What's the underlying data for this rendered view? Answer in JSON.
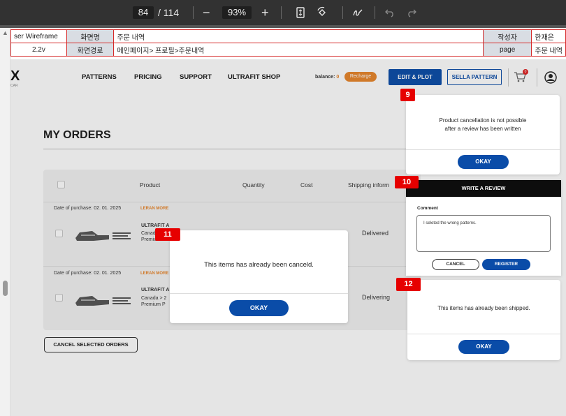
{
  "viewer": {
    "current_page": "84",
    "total_pages": "/ 114",
    "zoom": "93%",
    "minus_label": "−",
    "plus_label": "+"
  },
  "meta_table": {
    "row1": {
      "col1": "ser Wireframe",
      "col2": "화면명",
      "col3": "주문 내역",
      "col4": "작성자",
      "col5": "한재은"
    },
    "row2": {
      "col1": "2.2v",
      "col2": "화면경로",
      "col3": "메인페이지> 프로필>주문내역",
      "col4": "page",
      "col5": "주문 내역"
    }
  },
  "nav": {
    "logo": "X",
    "logo_sub": "CAR",
    "items": [
      "PATTERNS",
      "PRICING",
      "SUPPORT",
      "ULTRAFIT SHOP"
    ],
    "balance_label": "balance:",
    "balance_value": "0",
    "recharge": "Recharge",
    "edit_plot": "EDIT & PLOT",
    "sella_pattern": "SELLA PATTERN",
    "cart_count": "0"
  },
  "orders": {
    "title": "MY ORDERS",
    "headers": {
      "product": "Product",
      "quantity": "Quantity",
      "cost": "Cost",
      "shipping": "Shipping inform"
    },
    "groups": [
      {
        "date": "Date of purchase: 02. 01. 2025",
        "learn_more": "LERAN MORE",
        "product_name": "ULTRAFIT A",
        "line1": "Canada",
        "line2": "Premium",
        "status": "Delivered"
      },
      {
        "date": "Date of purchase: 02. 01. 2025",
        "learn_more": "LERAN MORE",
        "product_name": "ULTRAFIT A",
        "line1": "Canada > 2",
        "line2": "Premium P",
        "status": "Delivering"
      }
    ],
    "cancel_selected": "CANCEL SELECTED ORDERS"
  },
  "dialogs": {
    "d9": {
      "badge": "9",
      "line1": "Product cancellation is not possible",
      "line2": "after a review has been written",
      "ok": "OKAY"
    },
    "d10": {
      "badge": "10",
      "title": "WRITE A REVIEW",
      "comment_label": "Comment",
      "comment_text": "I seleted the wrong patterns.",
      "cancel": "CANCEL",
      "register": "REGISTER"
    },
    "d11": {
      "badge": "11",
      "message": "This items has already been canceld.",
      "ok": "OKAY"
    },
    "d12": {
      "badge": "12",
      "message": "This items has already been shipped.",
      "ok": "OKAY"
    }
  },
  "colors": {
    "accent_blue": "#0a4ca8",
    "badge_red": "#e60000",
    "link_orange": "#e8842a"
  }
}
